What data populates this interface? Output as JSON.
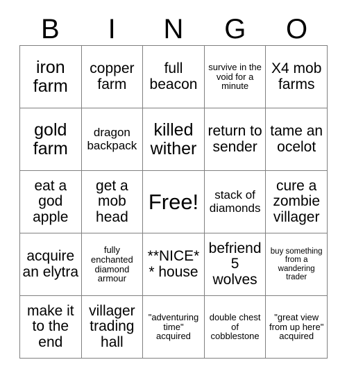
{
  "card": {
    "title": "BINGO",
    "header_letters": [
      "B",
      "I",
      "N",
      "G",
      "O"
    ],
    "colors": {
      "text": "#000000",
      "border": "#808080",
      "background": "#ffffff"
    },
    "free_space": {
      "row": 3,
      "column": 3,
      "label": "Free!"
    },
    "rows": [
      [
        {
          "text": "iron farm",
          "size": "lg"
        },
        {
          "text": "copper farm",
          "size": "md"
        },
        {
          "text": "full beacon",
          "size": "md"
        },
        {
          "text": "survive in the void for a minute",
          "size": "xs"
        },
        {
          "text": "X4 mob farms",
          "size": "md"
        }
      ],
      [
        {
          "text": "gold farm",
          "size": "lg"
        },
        {
          "text": "dragon backpack",
          "size": "sm"
        },
        {
          "text": "killed wither",
          "size": "lg"
        },
        {
          "text": "return to sender",
          "size": "md"
        },
        {
          "text": "tame an ocelot",
          "size": "md"
        }
      ],
      [
        {
          "text": "eat a god apple",
          "size": "md"
        },
        {
          "text": "get a mob head",
          "size": "md"
        },
        {
          "text": "Free!",
          "size": "xl"
        },
        {
          "text": "stack of diamonds",
          "size": "sm"
        },
        {
          "text": "cure a zombie villager",
          "size": "md"
        }
      ],
      [
        {
          "text": "acquire an elytra",
          "size": "md"
        },
        {
          "text": "fully enchanted diamond armour",
          "size": "xs"
        },
        {
          "text": "**NICE** house",
          "size": "md"
        },
        {
          "text": "befriend 5 wolves",
          "size": "md"
        },
        {
          "text": "buy something from a wandering trader",
          "size": "xxs"
        }
      ],
      [
        {
          "text": "make it to the end",
          "size": "md"
        },
        {
          "text": "villager trading hall",
          "size": "md"
        },
        {
          "text": "\"adventuring time\" acquired",
          "size": "xs"
        },
        {
          "text": "double chest of cobblestone",
          "size": "xs"
        },
        {
          "text": "\"great view from up here\" acquired",
          "size": "xs"
        }
      ]
    ]
  }
}
